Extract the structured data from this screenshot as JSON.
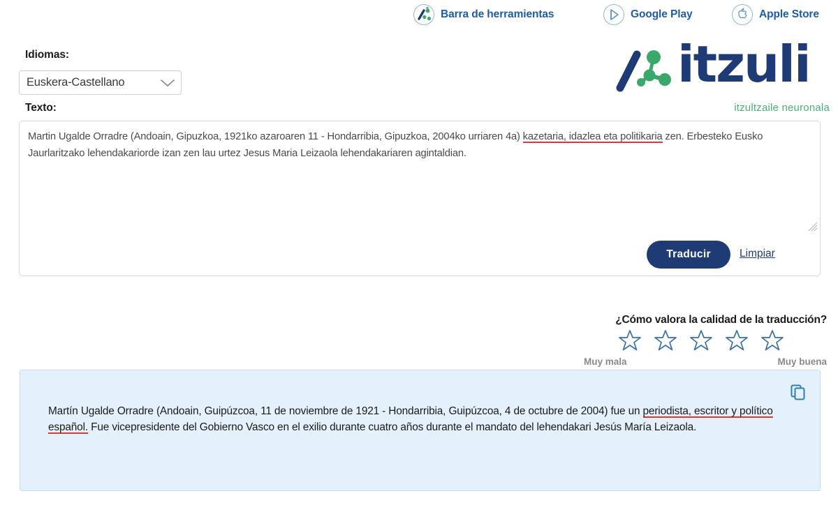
{
  "topbar": {
    "links": [
      {
        "label": "Barra de herramientas",
        "icon": "itzuli-toolbar-icon"
      },
      {
        "label": "Google Play",
        "icon": "google-play-icon"
      },
      {
        "label": "Apple Store",
        "icon": "apple-store-icon"
      }
    ]
  },
  "brand": {
    "wordmark": "itzuli",
    "tagline": "itzultzaile neuronala",
    "color_dark": "#1f3b76",
    "color_green": "#3aa86b"
  },
  "form": {
    "languages_label": "Idiomas:",
    "language_pair_selected": "Euskera-Castellano",
    "language_pair_options": [
      "Euskera-Castellano"
    ],
    "chevron_icon": "chevron-down-icon",
    "text_label": "Texto:",
    "source_text_part1": "Martin Ugalde Orradre (Andoain, Gipuzkoa, 1921ko azaroaren 11 - Hondarribia, Gipuzkoa, 2004ko urriaren 4a) ",
    "source_text_highlight": "kazetaria, idazlea eta politikaria",
    "source_text_part2": " zen. Erbesteko Eusko Jaurlaritzako lehendakariorde izan zen lau urtez Jesus Maria Leizaola lehendakariaren agintaldian.",
    "source_placeholder": "",
    "translate_button": "Traducir",
    "clear_link": "Limpiar",
    "resize_handle_icon": "resize-grip-icon"
  },
  "rating": {
    "question": "¿Cómo valora la calidad de la traducción?",
    "low_label": "Muy mala",
    "high_label": "Muy buena",
    "stars_total": 5,
    "stars_selected": 0,
    "star_color": "#3b6fa8"
  },
  "output": {
    "text_part1": "Martín Ugalde Orradre (Andoain, Guipúzcoa, 11 de noviembre de 1921 - Hondarribia, Guipúzcoa, 4 de octubre de 2004) fue un ",
    "text_highlight": "periodista, escritor y político español.",
    "text_part2": " Fue vicepresidente del Gobierno Vasco en el exilio durante cuatro años durante el mandato del lehendakari Jesús María Leizaola.",
    "copy_icon": "copy-icon",
    "background_color": "#e4f0fb",
    "highlight_color": "#e03a2f"
  }
}
